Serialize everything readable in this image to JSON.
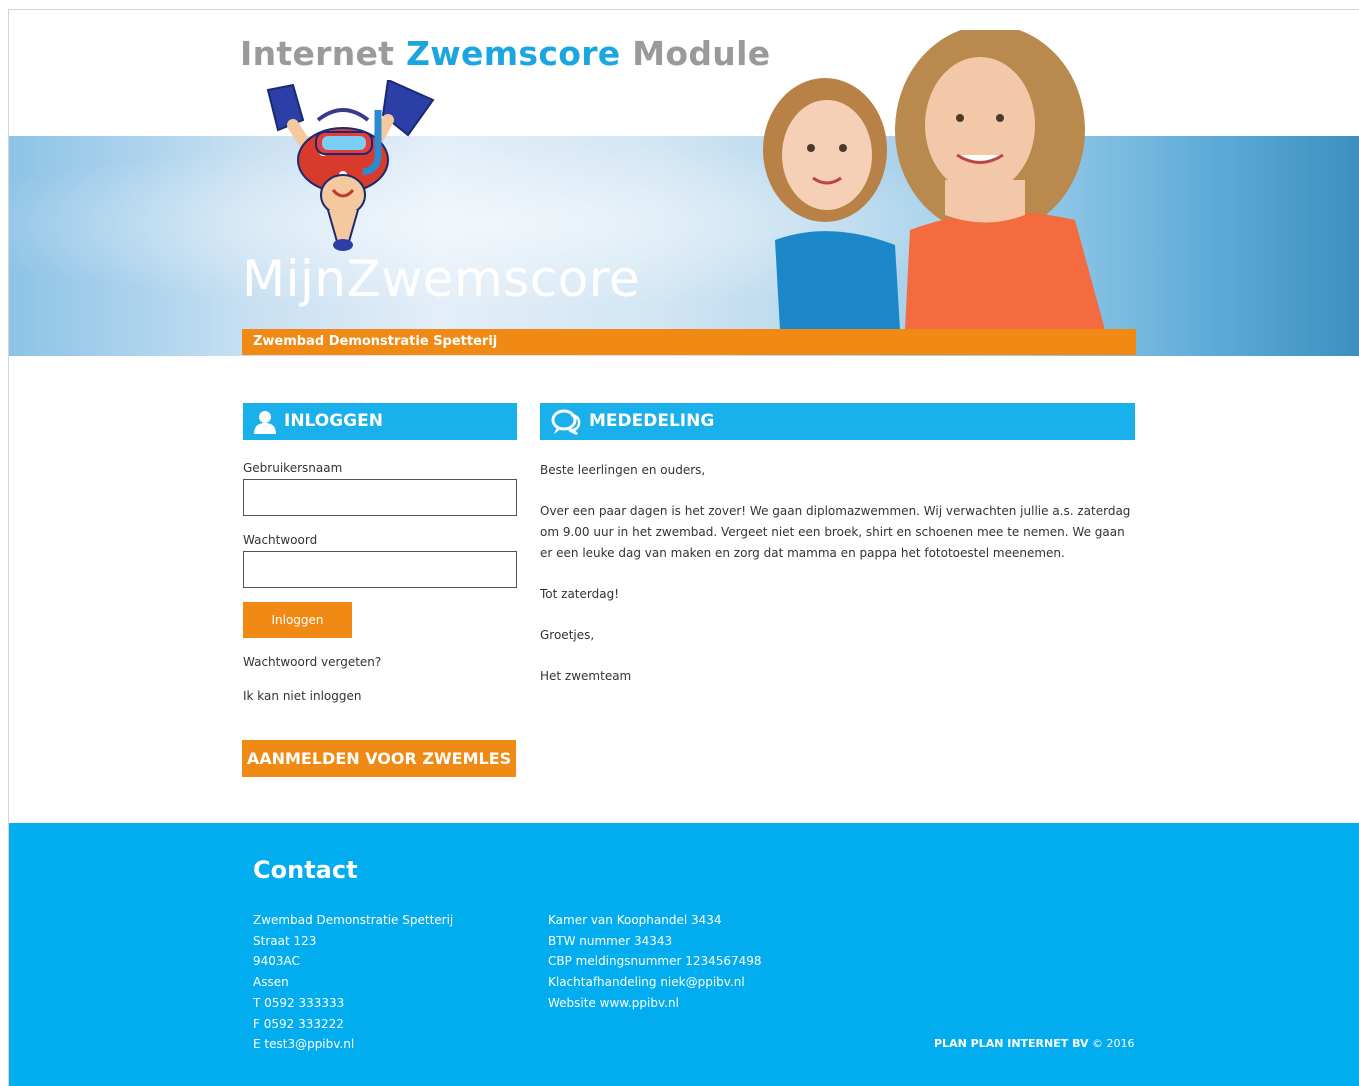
{
  "header": {
    "title_part1": "Internet ",
    "title_accent": "Zwemscore",
    "title_part2": " Module",
    "brand": "MijnZwemscore",
    "pool_name": "Zwembad Demonstratie Spetterij"
  },
  "login": {
    "heading": "INLOGGEN",
    "username_label": "Gebruikersnaam",
    "username_value": "",
    "password_label": "Wachtwoord",
    "password_value": "",
    "submit_label": "Inloggen",
    "forgot_link": "Wachtwoord vergeten?",
    "cannot_login_link": "Ik kan niet inloggen",
    "signup_label": "AANMELDEN VOOR ZWEMLES"
  },
  "notice": {
    "heading": "MEDEDELING",
    "paragraphs": [
      "Beste leerlingen en ouders,",
      "Over een paar dagen is het zover! We gaan diplomazwemmen. Wij verwachten jullie a.s. zaterdag om 9.00 uur in het zwembad. Vergeet niet een broek, shirt en schoenen mee te nemen. We gaan er een leuke dag van maken en zorg dat mamma en pappa het fototoestel meenemen.",
      "Tot zaterdag!",
      "Groetjes,",
      "Het zwemteam"
    ]
  },
  "footer": {
    "contact_title": "Contact",
    "address": [
      "Zwembad Demonstratie Spetterij",
      "Straat 123",
      "9403AC",
      "Assen",
      "T 0592 333333",
      "F 0592 333222",
      "E test3@ppibv.nl"
    ],
    "company": [
      "Kamer van Koophandel 3434",
      "BTW nummer 34343",
      "CBP meldingsnummer 1234567498",
      "Klachtafhandeling niek@ppibv.nl",
      "Website www.ppibv.nl"
    ],
    "copyright_company": "PLAN PLAN INTERNET BV",
    "copyright_year": "© 2016"
  },
  "colors": {
    "accent_blue": "#1ab0ec",
    "accent_orange": "#f18a14",
    "footer_blue": "#01adef"
  },
  "icons": {
    "login": "user-icon",
    "notice": "speech-bubbles-icon"
  }
}
